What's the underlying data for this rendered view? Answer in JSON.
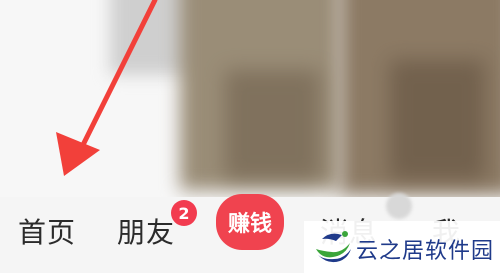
{
  "bottom_nav": {
    "home_label": "首页",
    "friends_label": "朋友",
    "friends_badge": "2",
    "earn_label": "赚钱",
    "messages_label": "消息",
    "me_label": "我"
  },
  "watermark": {
    "text": "云之居软件园"
  },
  "colors": {
    "accent_red": "#f0434f",
    "badge_red": "#f23b4f",
    "annotation_arrow": "#f2403a",
    "watermark_blue": "#1f3a8a",
    "watermark_green": "#3aa53a"
  }
}
